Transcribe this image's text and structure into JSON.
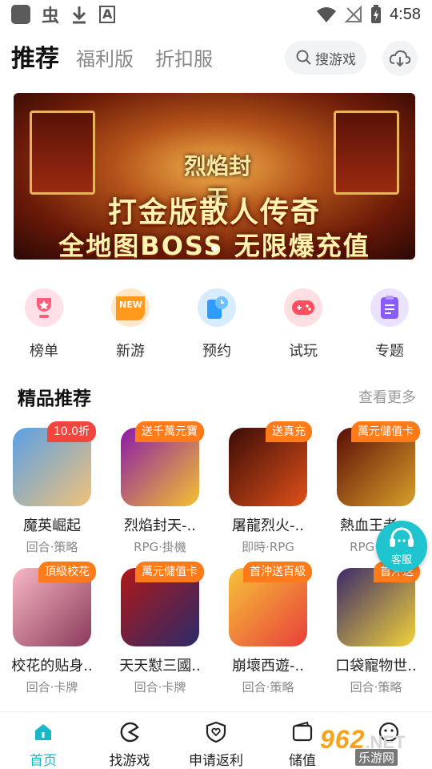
{
  "status_bar": {
    "time": "4:58",
    "glyph1": "虫",
    "glyph2": "A"
  },
  "header": {
    "tabs": [
      {
        "label": "推荐"
      },
      {
        "label": "福利版"
      },
      {
        "label": "折扣服"
      }
    ],
    "search_label": "搜游戏"
  },
  "banner": {
    "logo_text": "烈焰封天",
    "line1": "打金版散人传奇",
    "line2": "全地图BOSS 无限爆充值"
  },
  "quick_menu": [
    {
      "label": "榜单",
      "icon": "trophy-icon",
      "color": "#ff5c7a"
    },
    {
      "label": "新游",
      "icon": "new-icon",
      "color": "#ff9a1f"
    },
    {
      "label": "预约",
      "icon": "clock-icon",
      "color": "#2f9bff"
    },
    {
      "label": "试玩",
      "icon": "gamepad-icon",
      "color": "#ff4f5e"
    },
    {
      "label": "专题",
      "icon": "list-icon",
      "color": "#8a5cff"
    }
  ],
  "featured": {
    "title": "精品推荐",
    "more_label": "查看更多",
    "games": [
      {
        "name": "魔英崛起",
        "tags": "回合·策略",
        "badge": "10.0折",
        "badge_style": "red",
        "colors": [
          "#5aa0e6",
          "#f0c27a"
        ]
      },
      {
        "name": "烈焰封天-..",
        "tags": "RPG·掛機",
        "badge": "送千萬元寶",
        "badge_style": "orange",
        "colors": [
          "#8a1aa8",
          "#f2c230"
        ]
      },
      {
        "name": "屠龍烈火-..",
        "tags": "即時·RPG",
        "badge": "送真充",
        "badge_style": "orange",
        "colors": [
          "#3a0c06",
          "#e0501a"
        ]
      },
      {
        "name": "熱血王者-..",
        "tags": "RPG·掛機",
        "badge": "萬元儲值卡",
        "badge_style": "orange",
        "colors": [
          "#5a0c06",
          "#d8a02a"
        ]
      },
      {
        "name": "校花的贴身..",
        "tags": "回合·卡牌",
        "badge": "頂級校花",
        "badge_style": "orange",
        "colors": [
          "#f7b8c4",
          "#8a3a5a"
        ]
      },
      {
        "name": "天天懟三國..",
        "tags": "回合·卡牌",
        "badge": "萬元儲值卡",
        "badge_style": "orange",
        "colors": [
          "#b01818",
          "#2a2a6a"
        ]
      },
      {
        "name": "崩壞西遊-..",
        "tags": "回合·策略",
        "badge": "首沖送百級",
        "badge_style": "orange",
        "colors": [
          "#f7c23a",
          "#e8403a"
        ]
      },
      {
        "name": "口袋寵物世..",
        "tags": "回合·策略",
        "badge": "首沖送",
        "badge_style": "orange",
        "colors": [
          "#3a2a6a",
          "#f2d23a"
        ]
      }
    ]
  },
  "service": {
    "label": "客服"
  },
  "bottom_nav": [
    {
      "label": "首页",
      "icon": "home-icon",
      "active": true
    },
    {
      "label": "找游戏",
      "icon": "pacman-icon",
      "active": false
    },
    {
      "label": "申请返利",
      "icon": "shield-heart-icon",
      "active": false
    },
    {
      "label": "储值",
      "icon": "wallet-icon",
      "active": false
    },
    {
      "label": "",
      "icon": "profile-icon",
      "active": false
    }
  ],
  "watermark": {
    "num": "962",
    "net": ".NET",
    "sub": "乐游网"
  },
  "colors": {
    "accent": "#18b8c8",
    "badge_orange": "#ff7a18",
    "badge_red": "#f1453d"
  }
}
